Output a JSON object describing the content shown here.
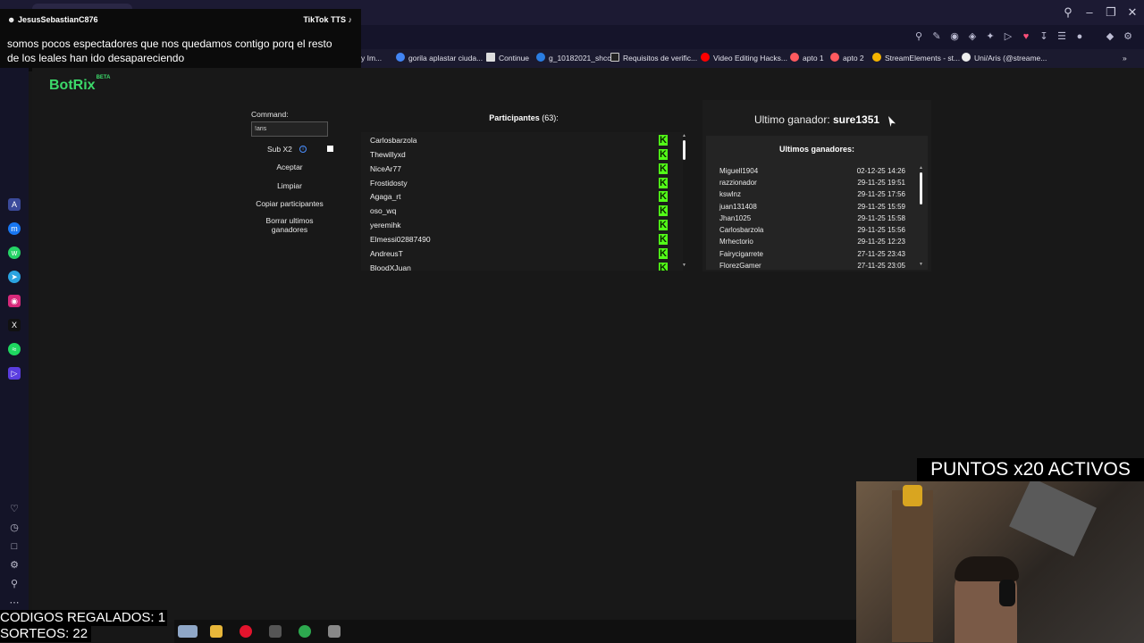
{
  "overlay_tiktok": {
    "user": "JesusSebastianC876",
    "brand": "TikTok TTS",
    "message": "somos pocos espectadores que nos quedamos contigo porq el resto de los leales han ido desapareciendo"
  },
  "bookmarks": [
    {
      "label": "y Im...",
      "icon_color": "#ffffff"
    },
    {
      "label": "gorila aplastar ciuda...",
      "icon_color": "#4285f4"
    },
    {
      "label": "Continue",
      "icon_color": "#ffffff"
    },
    {
      "label": "g_10182021_shcc",
      "icon_color": "#2a7de1"
    },
    {
      "label": "Requisitos de verific...",
      "icon_color": "#ffffff"
    },
    {
      "label": "Video Editing Hacks...",
      "icon_color": "#ff0000"
    },
    {
      "label": "apto 1",
      "icon_color": "#ff5a5f"
    },
    {
      "label": "apto 2",
      "icon_color": "#ff5a5f"
    },
    {
      "label": "StreamElements - st...",
      "icon_color": "#f5b400"
    },
    {
      "label": "Uni/Aris (@streame...",
      "icon_color": "#ffffff"
    }
  ],
  "brand": {
    "name": "BotRix",
    "tag": "BETA"
  },
  "command_panel": {
    "label": "Command:",
    "input_value": "!aris",
    "sub_label": "Sub X2",
    "accept": "Aceptar",
    "clear": "Limpiar",
    "copy": "Copiar participantes",
    "delete": "Borrar ultimos ganadores"
  },
  "participants": {
    "title": "Participantes",
    "count": "(63)",
    "colon": ":",
    "items": [
      "Carlosbarzola",
      "Thewillyxd",
      "NiceAr77",
      "Frostidosty",
      "Agaga_rt",
      "oso_wq",
      "yeremihk",
      "Elmessi02887490",
      "AndreusT",
      "BloodXJuan"
    ]
  },
  "winner": {
    "label": "Ultimo ganador:",
    "name": "sure1351"
  },
  "winners_list": {
    "title": "Ultimos ganadores:",
    "rows": [
      {
        "name": "Miguell1904",
        "date": "02-12-25 14:26"
      },
      {
        "name": "razzionador",
        "date": "29-11-25 19:51"
      },
      {
        "name": "kswlnz",
        "date": "29-11-25 17:56"
      },
      {
        "name": "juan131408",
        "date": "29-11-25 15:59"
      },
      {
        "name": "Jhan1025",
        "date": "29-11-25 15:58"
      },
      {
        "name": "Carlosbarzola",
        "date": "29-11-25 15:56"
      },
      {
        "name": "Mrhectorio",
        "date": "29-11-25 12:23"
      },
      {
        "name": "Fairycigarrete",
        "date": "27-11-25 23:43"
      },
      {
        "name": "FlorezGamer",
        "date": "27-11-25 23:05"
      }
    ]
  },
  "stream": {
    "puntos": "PUNTOS x20 ACTIVOS",
    "codigos": "CODIGOS REGALADOS: 1",
    "sorteos": "SORTEOS: 22"
  },
  "colors": {
    "kick_green": "#53fc18",
    "brand_green": "#3cd96a"
  }
}
